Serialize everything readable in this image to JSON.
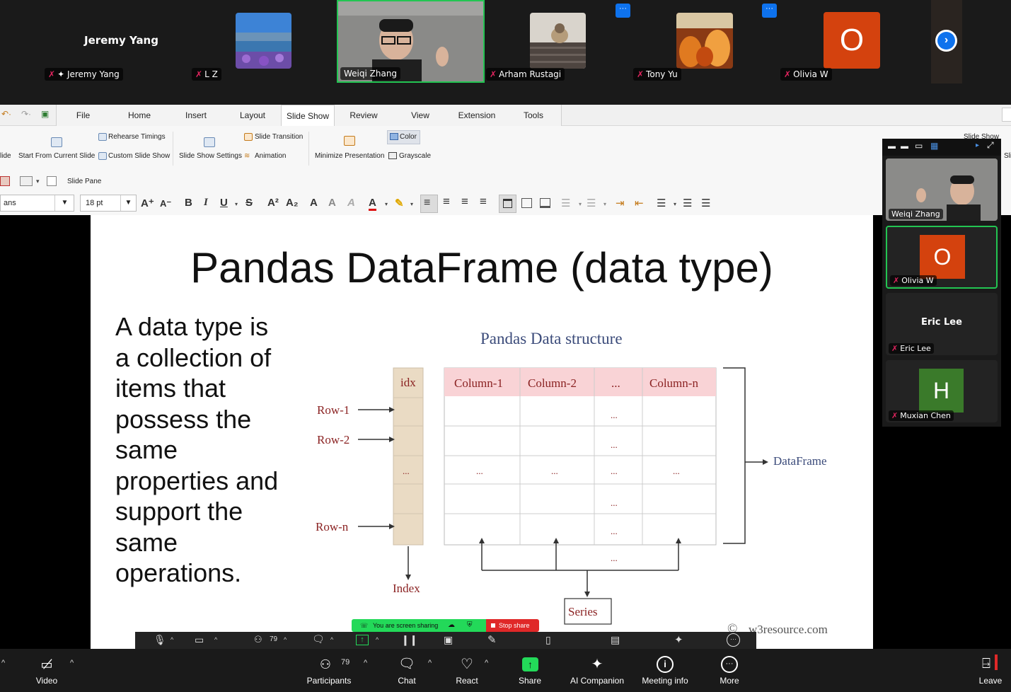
{
  "participants_strip": {
    "jeremy": {
      "display": "Jeremy Yang",
      "tag": "Jeremy Yang"
    },
    "lz": {
      "tag": "L Z"
    },
    "weiqi": {
      "tag": "Weiqi Zhang"
    },
    "arham": {
      "tag": "Arham Rustagi"
    },
    "tony": {
      "tag": "Tony Yu"
    },
    "olivia": {
      "tag": "Olivia W",
      "initial": "O"
    },
    "more_dots": "···"
  },
  "ribbon": {
    "tabs": [
      "File",
      "Home",
      "Insert",
      "Layout",
      "Slide Show",
      "Review",
      "View",
      "Extension",
      "Tools"
    ],
    "active_tab": "Slide Show",
    "groups": {
      "slide": "lide",
      "start_current": "Start From Current Slide",
      "rehearse": "Rehearse Timings",
      "custom": "Custom Slide Show",
      "settings": "Slide Show Settings",
      "transition": "Slide Transition",
      "animation": "Animation",
      "minimize": "Minimize Presentation",
      "color": "Color",
      "grayscale": "Grayscale",
      "slide_pane": "Slide Pane",
      "right_cut": "Slide Show",
      "right_cut2": "Sli"
    },
    "font_name": "ans",
    "font_size": "18 pt"
  },
  "slide": {
    "title": "Pandas DataFrame (data type)",
    "body": "A data type is a collection of items that possess the same properties and support the same operations.",
    "diagram": {
      "heading": "Pandas Data structure",
      "index_header": "idx",
      "columns": [
        "Column-1",
        "Column-2",
        "...",
        "Column-n"
      ],
      "row_labels": [
        "Row-1",
        "Row-2",
        "Row-n"
      ],
      "ellipsis": "...",
      "dataframe_label": "DataFrame",
      "index_label": "Index",
      "series_label": "Series",
      "watermark": "w3resource.com",
      "copyright": "©"
    }
  },
  "gallery": {
    "weiqi": "Weiqi Zhang",
    "olivia": {
      "tag": "Olivia W",
      "initial": "O"
    },
    "eric": {
      "display": "Eric Lee",
      "tag": "Eric Lee"
    },
    "muxian": {
      "tag": "Muxian Chen",
      "initial": "H"
    }
  },
  "share": {
    "status": "You are screen sharing",
    "stop": "Stop share",
    "participants_count": "79"
  },
  "toolbar": {
    "video": "Video",
    "participants": "Participants",
    "participants_count": "79",
    "chat": "Chat",
    "react": "React",
    "share": "Share",
    "ai": "AI Companion",
    "info": "Meeting info",
    "more": "More",
    "leave": "Leave"
  },
  "colors": {
    "olivia_avatar": "#d4420e",
    "muxian_avatar": "#3a7a2a",
    "share_green": "#23d959",
    "stop_red": "#e02828",
    "active_speaker": "#23c552",
    "column_header_pink": "#f9d3d6",
    "index_tan": "#eadbc4"
  }
}
